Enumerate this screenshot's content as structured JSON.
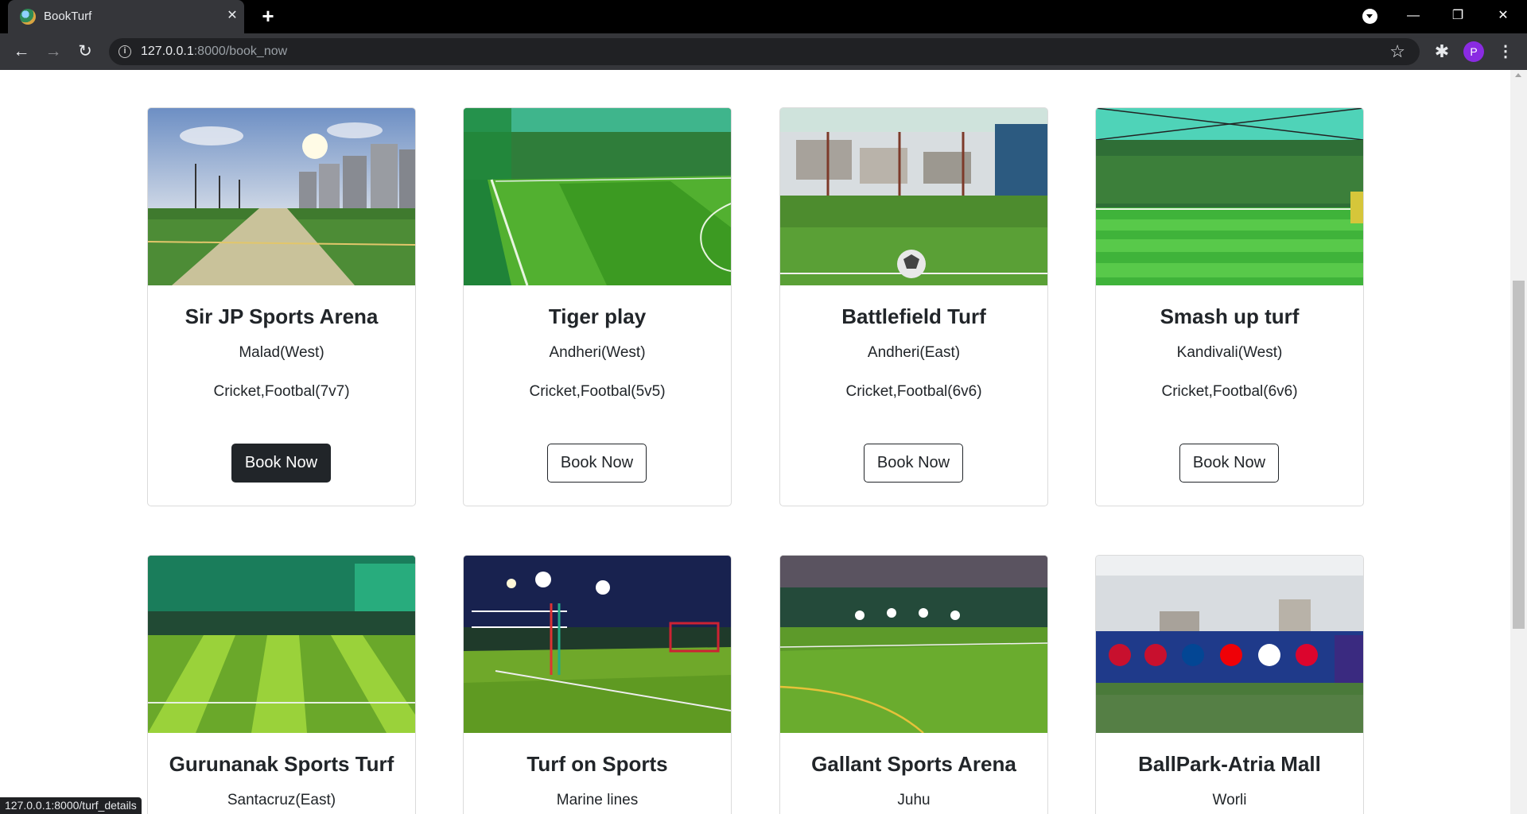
{
  "browser": {
    "tab_title": "BookTurf",
    "url_host": "127.0.0.1",
    "url_path": ":8000/book_now",
    "profile_initial": "P",
    "status_url": "127.0.0.1:8000/turf_details"
  },
  "turfs": [
    {
      "name": "Sir JP Sports Arena",
      "location": "Malad(West)",
      "sports": "Cricket,Footbal(7v7)",
      "button": "Book Now"
    },
    {
      "name": "Tiger play",
      "location": "Andheri(West)",
      "sports": "Cricket,Footbal(5v5)",
      "button": "Book Now"
    },
    {
      "name": "Battlefield Turf",
      "location": "Andheri(East)",
      "sports": "Cricket,Footbal(6v6)",
      "button": "Book Now"
    },
    {
      "name": "Smash up turf",
      "location": "Kandivali(West)",
      "sports": "Cricket,Footbal(6v6)",
      "button": "Book Now"
    },
    {
      "name": "Gurunanak Sports Turf",
      "location": "Santacruz(East)"
    },
    {
      "name": "Turf on Sports",
      "location": "Marine lines"
    },
    {
      "name": "Gallant Sports Arena",
      "location": "Juhu"
    },
    {
      "name": "BallPark-Atria Mall",
      "location": "Worli"
    }
  ]
}
